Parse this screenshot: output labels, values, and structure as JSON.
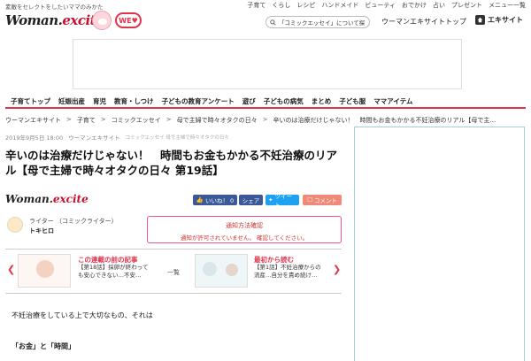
{
  "header": {
    "tagline": "素敵をセレクトをしたいママのみかた",
    "top_links": [
      "子育て",
      "くらし",
      "レシピ",
      "ハンドメイド",
      "ビューティ",
      "おでかけ",
      "占い",
      "プレゼント",
      "メニュー一覧"
    ],
    "logo": {
      "main": "Woman.",
      "accent": "excite"
    },
    "we_badge": "WE",
    "search_value": "「コミックエッセイ」について探す",
    "top_link": "ウーマンエキサイトトップ",
    "excite_home": "エキサイト"
  },
  "category_nav": [
    "子育てトップ",
    "妊娠出産",
    "育児",
    "教育・しつけ",
    "子どもの教育アンケート",
    "遊び",
    "子どもの病気",
    "まとめ",
    "子ども服",
    "ママアイテム"
  ],
  "breadcrumb": [
    "ウーマンエキサイト",
    "子育て",
    "コミックエッセイ",
    "母で主婦で時々オタクの日々",
    "辛いのは治療だけじゃない！　時間もお金もかかる不妊治療のリアル【母で主…"
  ],
  "meta": {
    "date": "2019年9月5日 18:00",
    "source": "ウーマンエキサイト",
    "small": "コミックエッセイ 母で主婦で時々オタクの日々"
  },
  "article": {
    "title": "辛いのは治療だけじゃない！　時間もお金もかかる不妊治療のリアル【母で主婦で時々オタクの日々 第19話】",
    "logo": {
      "main": "Woman.",
      "accent": "excite"
    },
    "share": {
      "like": "いいね！ 0",
      "facebook": "シェア",
      "twitter": "ツイート",
      "comment": "コメント"
    },
    "writer": {
      "role": "ライター （コミックライター）",
      "name": "トキヒロ"
    },
    "notice": {
      "title": "通知方法確認",
      "desc": "通知が許可されていません。 確認してください。"
    },
    "prev": {
      "title": "この連載の前の記事",
      "desc": "【第18話】採卵が終わっても安心できない…不安…"
    },
    "list_link": "一覧",
    "first": {
      "title": "最初から読む",
      "desc": "【第1話】不妊治療からの流産…自分を責め続け…"
    },
    "paragraphs": [
      "不妊治療をしている上で大切なもの、それは",
      "「お金」と「時間」"
    ]
  },
  "colors": {
    "accent": "#e0344d",
    "facebook": "#3b5998",
    "twitter": "#1da1f2",
    "comment": "#f08a78"
  }
}
